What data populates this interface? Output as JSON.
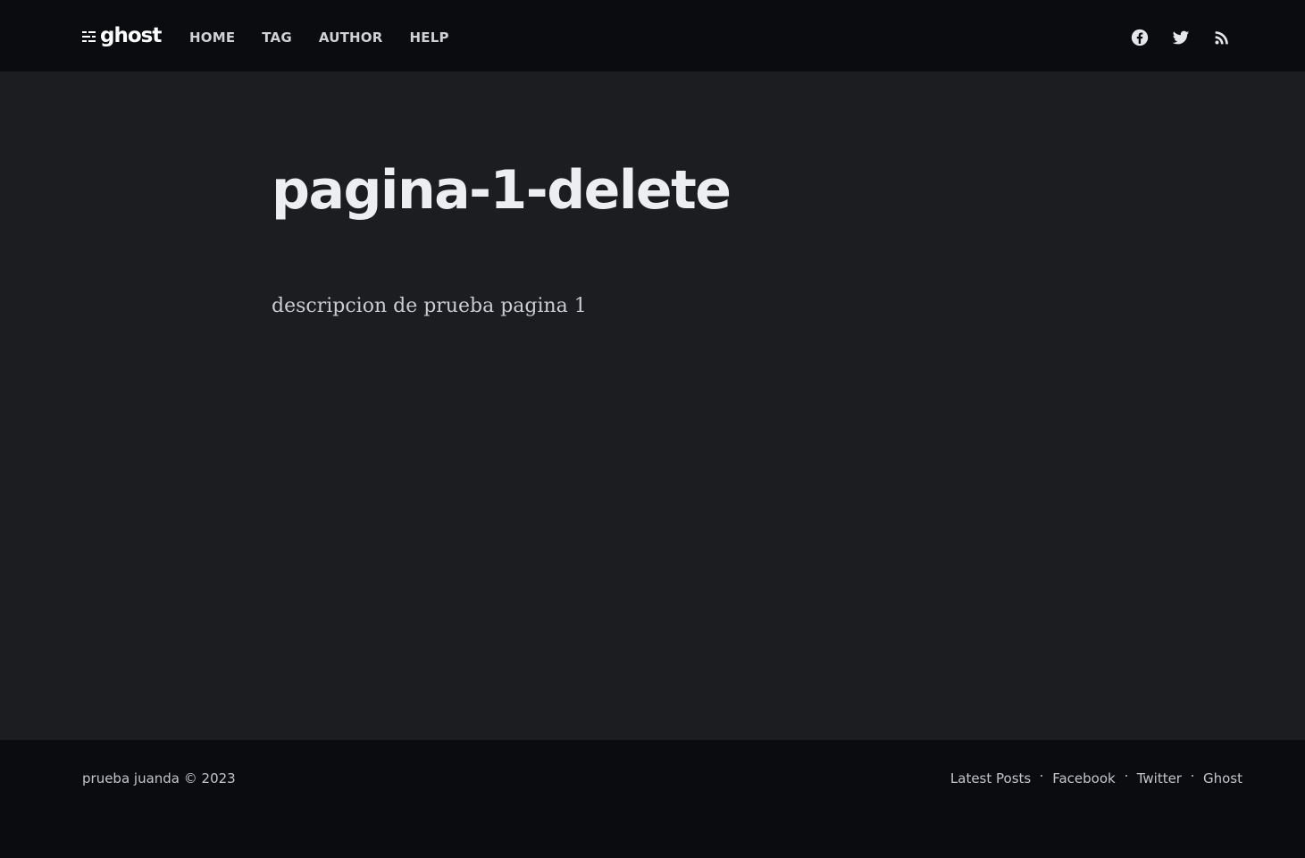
{
  "header": {
    "logo_text": "ghost",
    "logo_icon": "ghost-logo-icon",
    "nav": [
      {
        "label": "HOME"
      },
      {
        "label": "TAG"
      },
      {
        "label": "AUTHOR"
      },
      {
        "label": "HELP"
      }
    ],
    "social": [
      {
        "name": "facebook-icon"
      },
      {
        "name": "twitter-icon"
      },
      {
        "name": "rss-icon"
      }
    ]
  },
  "main": {
    "title": "pagina-1-delete",
    "body": "descripcion de prueba pagina 1"
  },
  "footer": {
    "copyright": "prueba juanda © 2023",
    "links": [
      {
        "label": "Latest Posts"
      },
      {
        "label": "Facebook"
      },
      {
        "label": "Twitter"
      },
      {
        "label": "Ghost"
      }
    ]
  },
  "colors": {
    "header_bg": "#0b0c0f",
    "main_bg": "#1c1d21",
    "title_text": "#eceef1",
    "body_text": "#c9ccd1"
  }
}
